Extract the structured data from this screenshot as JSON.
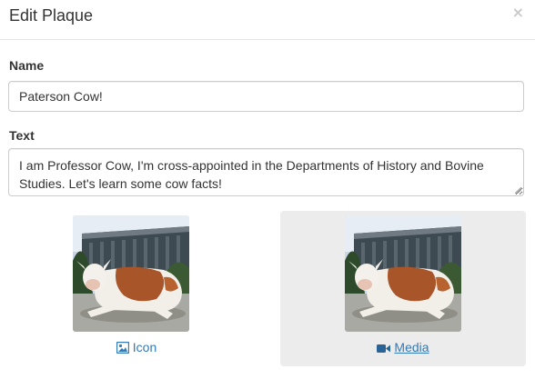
{
  "modal": {
    "title": "Edit Plaque",
    "close_glyph": "×"
  },
  "form": {
    "name_label": "Name",
    "name_value": "Paterson Cow!",
    "text_label": "Text",
    "text_value": "I am Professor Cow, I'm cross-appointed in the Departments of History and Bovine Studies. Let's learn some cow facts!"
  },
  "tiles": [
    {
      "label": "Icon",
      "icon": "image-icon",
      "selected": false
    },
    {
      "label": "Media",
      "icon": "video-camera-icon",
      "selected": true
    }
  ],
  "colors": {
    "link": "#337ab7",
    "selected_tile_bg": "#ececec",
    "border": "#cccccc"
  }
}
